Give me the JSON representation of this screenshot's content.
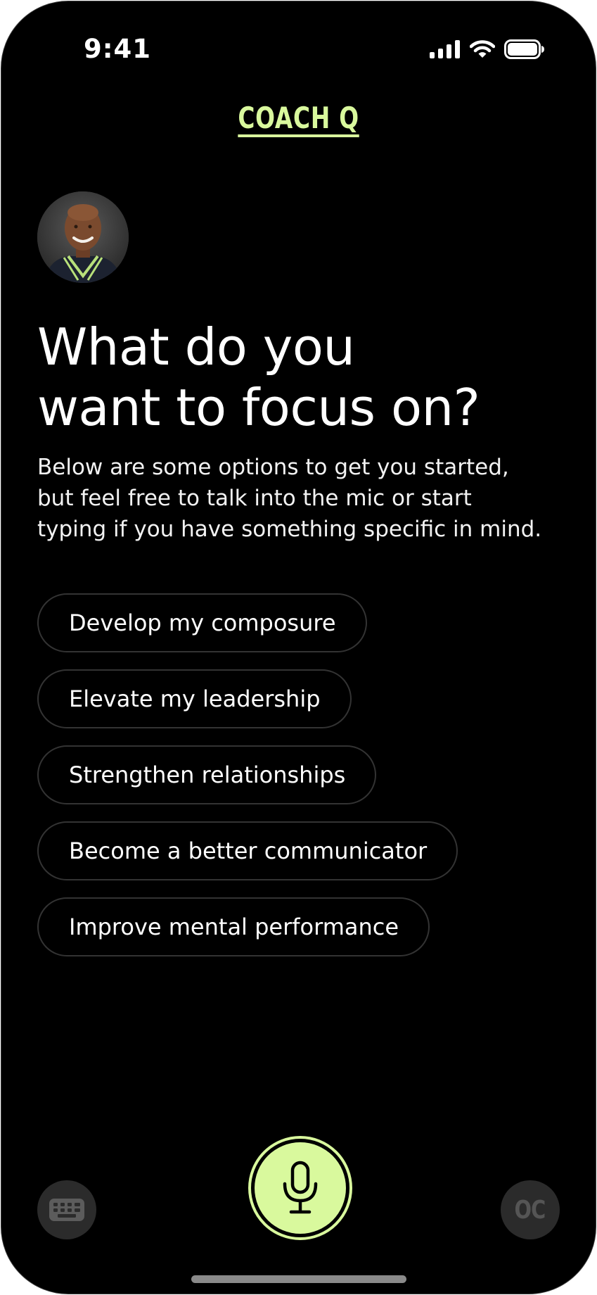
{
  "status_bar": {
    "time": "9:41",
    "icons": [
      "cellular-signal-icon",
      "wifi-icon",
      "battery-icon"
    ]
  },
  "header": {
    "brand": "COACH Q"
  },
  "coach": {
    "avatar": "coach-avatar"
  },
  "main": {
    "title": "What do you\nwant to focus on?",
    "subtitle": "Below are some options to get you started,\nbut feel free to talk into the mic or start\ntyping if you have something specific in mind.",
    "options": [
      {
        "label": "Develop my composure"
      },
      {
        "label": "Elevate my leadership"
      },
      {
        "label": "Strengthen relationships"
      },
      {
        "label": "Become a better communicator"
      },
      {
        "label": "Improve mental performance"
      }
    ]
  },
  "bottom_bar": {
    "keyboard_icon": "keyboard-icon",
    "mic_icon": "microphone-icon",
    "oc_label": "OC"
  },
  "colors": {
    "background": "#000000",
    "accent": "#d9f99d",
    "pill_border": "#333333",
    "muted_button": "#2b2b2b"
  }
}
